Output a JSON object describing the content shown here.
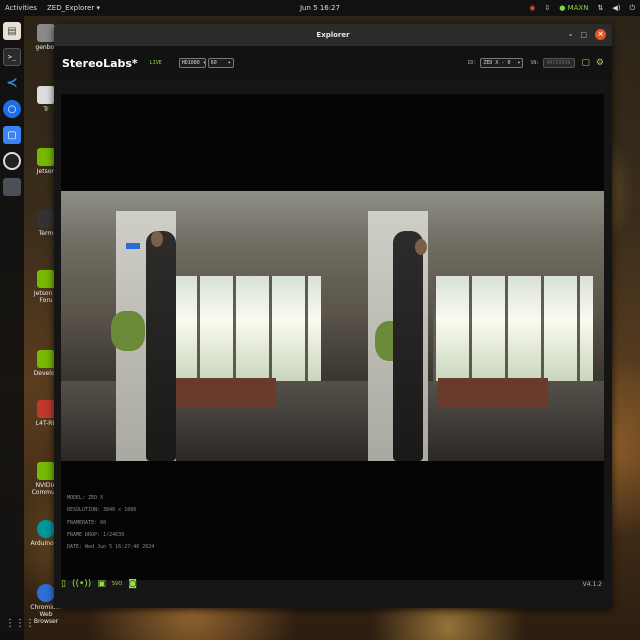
{
  "topbar": {
    "activities": "Activities",
    "app_name": "ZED_Explorer ▾",
    "clock": "Jun 5 16:27",
    "power_mode": "MAXN"
  },
  "desktop": {
    "icons": [
      {
        "label": "genbot"
      },
      {
        "label": "Tr"
      },
      {
        "label": "Jetson"
      },
      {
        "label": "Term"
      },
      {
        "label": "Jetson S Foru"
      },
      {
        "label": "Develop"
      },
      {
        "label": "L4T-RE"
      },
      {
        "label": "NVIDIA Communi"
      },
      {
        "label": "Arduino IC"
      },
      {
        "label": "Chromium Web Browser"
      }
    ]
  },
  "window": {
    "title": "Explorer",
    "controls": {
      "minimize": "–",
      "maximize": "□",
      "close": "×"
    }
  },
  "header": {
    "logo": "StereoLabs*",
    "status": "LIVE",
    "resolution": "HD1080",
    "fps": "60",
    "id_label": "ID:",
    "device": "ZED X - 0",
    "sn_label": "SN:",
    "serial": "40729998"
  },
  "info": {
    "model": "MODEL: ZED X",
    "resolution": "RESOLUTION: 3840 x 1080",
    "framerate": "FRAMERATE: 60",
    "frame_drop": "FRAME DROP: 1/24639",
    "date": "DATE: Wed Jun 5 16:27:40 2024"
  },
  "footer": {
    "version": "V4.1.2"
  },
  "colors": {
    "accent": "#9ad94b",
    "close": "#e95420"
  }
}
